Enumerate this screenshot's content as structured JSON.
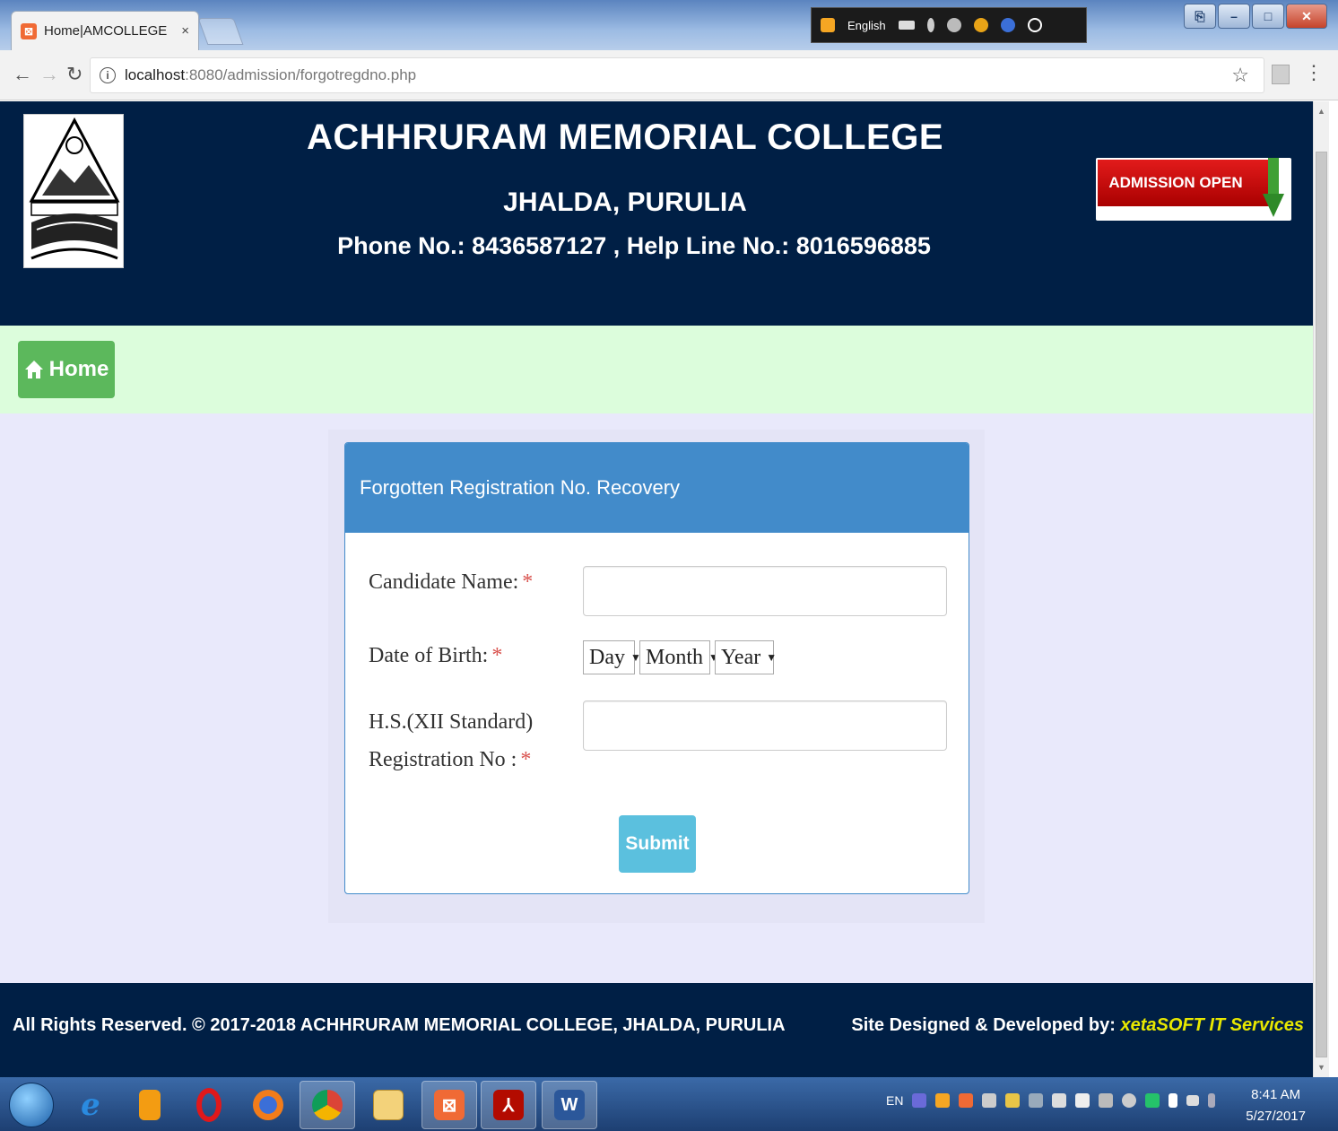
{
  "browser": {
    "tab_title": "Home|AMCOLLEGE",
    "tab_close": "×",
    "url_host": "localhost",
    "url_path": ":8080/admission/forgotregdno.php",
    "ime_language": "English"
  },
  "header": {
    "college_name": "ACHHRURAM MEMORIAL COLLEGE",
    "place": "JHALDA, PURULIA",
    "phone_line": "Phone No.: 8436587127 , Help Line No.: 8016596885",
    "admission_banner": "ADMISSION OPEN"
  },
  "nav": {
    "home_label": "Home"
  },
  "form": {
    "heading": "Forgotten Registration No. Recovery",
    "candidate_name_label": "Candidate Name:",
    "candidate_name_value": "",
    "dob_label": "Date of Birth:",
    "dob_day": "Day",
    "dob_month": "Month",
    "dob_year": "Year",
    "hs_label_line1": "H.S.(XII Standard)",
    "hs_label_line2": "Registration No :",
    "hs_reg_value": "",
    "required_mark": "*",
    "submit_label": "Submit"
  },
  "footer": {
    "rights_text": "All Rights Reserved. © 2017-2018 ACHHRURAM MEMORIAL COLLEGE, JHALDA, PURULIA",
    "designed_by_label": "Site Designed & Developed by:",
    "designer_name": "xetaSOFT IT Services"
  },
  "taskbar": {
    "tray_lang": "EN",
    "time": "8:41 AM",
    "date": "5/27/2017"
  },
  "colors": {
    "header_bg": "#001f45",
    "nav_bg": "#dcfddc",
    "page_bg": "#e9e9fb",
    "panel_primary": "#428bca",
    "home_green": "#5cb85c",
    "submit_blue": "#5bc0de",
    "required_red": "#d9534f",
    "brand_yellow": "#e8e800"
  }
}
